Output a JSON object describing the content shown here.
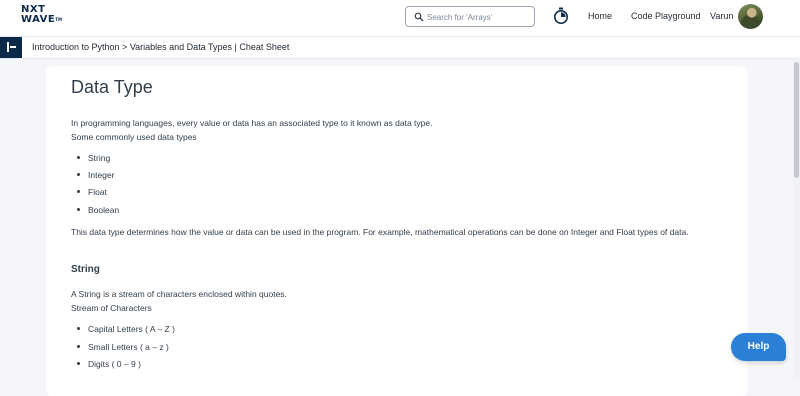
{
  "header": {
    "logo_line1": "NXT",
    "logo_line2": "WAVE",
    "logo_tm": "TM",
    "search_placeholder": "Search for 'Arrays'",
    "nav": {
      "home": "Home",
      "playground": "Code Playground",
      "user": "Varun"
    },
    "icons": [
      "search-icon",
      "timer-icon",
      "avatar"
    ]
  },
  "breadcrumb": {
    "text": "Introduction to Python > Variables and Data Types | Cheat Sheet"
  },
  "content": {
    "title": "Data Type",
    "intro_1": "In programming languages, every value or data has an associated type to it known as data type.",
    "intro_2": "Some commonly used data types",
    "types": [
      "String",
      "Integer",
      "Float",
      "Boolean"
    ],
    "usage": "This data type determines how the value or data can be used in the program. For example, mathematical operations can be done on Integer and Float types of data.",
    "string_heading": "String",
    "string_desc": "A String is a stream of characters enclosed within quotes.",
    "string_stream": "Stream of Characters",
    "char_kinds": [
      "Capital Letters ( A – Z )",
      "Small Letters ( a – z )",
      "Digits ( 0 – 9 )"
    ]
  },
  "help": {
    "label": "Help"
  },
  "colors": {
    "brand": "#0b2a4a",
    "help": "#2b7fd6",
    "page_bg": "#f4f6f9"
  }
}
